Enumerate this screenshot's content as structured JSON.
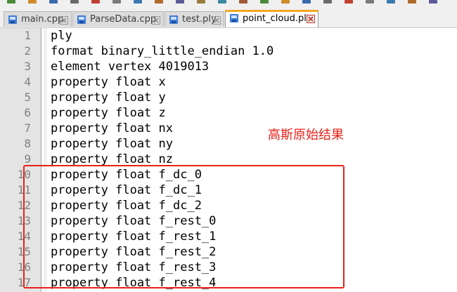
{
  "toolbar": {
    "icons": [
      "new-icon",
      "open-icon",
      "save-icon",
      "save-all-icon",
      "close-icon",
      "close-all-icon",
      "print-icon",
      "cut-icon",
      "copy-icon",
      "paste-icon",
      "undo-icon",
      "redo-icon",
      "find-icon",
      "replace-icon",
      "zoom-in-icon",
      "zoom-out-icon",
      "sync-icon",
      "wrap-icon",
      "show-all-icon",
      "indent-guide-icon",
      "macro-icon"
    ]
  },
  "tabs": [
    {
      "label": "main.cpp",
      "active": false
    },
    {
      "label": "ParseData.cpp",
      "active": false
    },
    {
      "label": "test.ply",
      "active": false
    },
    {
      "label": "point_cloud.ply",
      "active": true
    }
  ],
  "editor": {
    "lines": [
      {
        "num": "1",
        "text": "ply"
      },
      {
        "num": "2",
        "text": "format binary_little_endian 1.0"
      },
      {
        "num": "3",
        "text": "element vertex 4019013"
      },
      {
        "num": "4",
        "text": "property float x"
      },
      {
        "num": "5",
        "text": "property float y"
      },
      {
        "num": "6",
        "text": "property float z"
      },
      {
        "num": "7",
        "text": "property float nx"
      },
      {
        "num": "8",
        "text": "property float ny"
      },
      {
        "num": "9",
        "text": "property float nz"
      },
      {
        "num": "10",
        "text": "property float f_dc_0"
      },
      {
        "num": "11",
        "text": "property float f_dc_1"
      },
      {
        "num": "12",
        "text": "property float f_dc_2"
      },
      {
        "num": "13",
        "text": "property float f_rest_0"
      },
      {
        "num": "14",
        "text": "property float f_rest_1"
      },
      {
        "num": "15",
        "text": "property float f_rest_2"
      },
      {
        "num": "16",
        "text": "property float f_rest_3"
      },
      {
        "num": "17",
        "text": "property float f_rest_4"
      }
    ]
  },
  "annotation": {
    "text": "高斯原始结果",
    "color": "#e8211a"
  },
  "colors": {
    "accent_tab": "#f5a623",
    "annotation_red": "#e8211a",
    "line_number": "#808080"
  }
}
